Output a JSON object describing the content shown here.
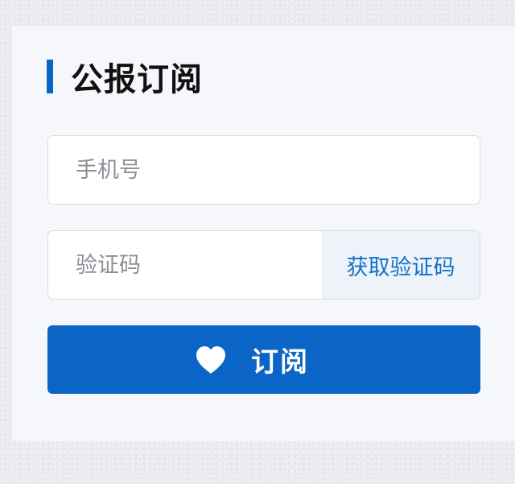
{
  "form": {
    "title": "公报订阅",
    "phone_placeholder": "手机号",
    "code_placeholder": "验证码",
    "get_code_label": "获取验证码",
    "subscribe_label": "订阅",
    "subscribe_icon": "heart-icon"
  },
  "colors": {
    "accent": "#0a65c6",
    "link": "#1470c8",
    "card_bg": "#f5f7fb",
    "code_button_bg": "#eef3fa"
  }
}
